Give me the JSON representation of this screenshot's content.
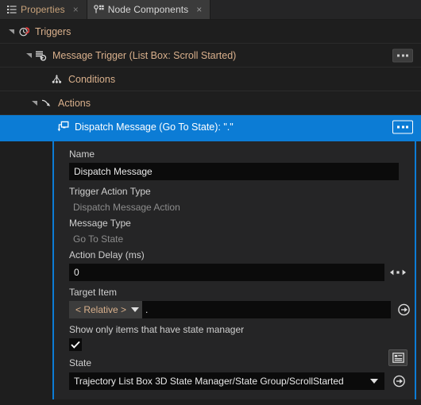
{
  "tabs": [
    {
      "label": "Properties",
      "icon": "list-icon",
      "active": false,
      "close": "×"
    },
    {
      "label": "Node Components",
      "icon": "node-components-icon",
      "active": true,
      "close": "×"
    }
  ],
  "tree": [
    {
      "label": "Triggers",
      "icon": "trigger-clock-icon",
      "indent": 0,
      "expanded": true,
      "selected": false,
      "menu": false
    },
    {
      "label": "Message Trigger (List Box: Scroll Started)",
      "icon": "message-trigger-icon",
      "indent": 1,
      "expanded": true,
      "selected": false,
      "menu": true
    },
    {
      "label": "Conditions",
      "icon": "conditions-icon",
      "indent": 2,
      "expanded": false,
      "selected": false,
      "menu": false
    },
    {
      "label": "Actions",
      "icon": "actions-icon",
      "indent": 2,
      "expanded": true,
      "selected": false,
      "menu": false
    },
    {
      "label": "Dispatch Message (Go To State): \".\"",
      "icon": "dispatch-message-icon",
      "indent": 3,
      "expanded": false,
      "selected": true,
      "menu": true
    }
  ],
  "detail": {
    "name_label": "Name",
    "name_value": "Dispatch Message",
    "trigger_action_type_label": "Trigger Action Type",
    "trigger_action_type_value": "Dispatch Message Action",
    "message_type_label": "Message Type",
    "message_type_value": "Go To State",
    "action_delay_label": "Action Delay (ms)",
    "action_delay_value": "0",
    "target_item_label": "Target Item",
    "target_item_mode": "< Relative >",
    "target_item_path": ".",
    "show_only_label": "Show only items that have state manager",
    "show_only_checked": true,
    "state_label": "State",
    "state_value": "Trajectory List Box 3D State Manager/State Group/ScrollStarted"
  },
  "colors": {
    "accent": "#0c7cd5",
    "tree_text": "#d9b08c",
    "panel_bg": "#252526",
    "tree_bg": "#1e1e1e",
    "input_bg": "#0b0b0b"
  }
}
